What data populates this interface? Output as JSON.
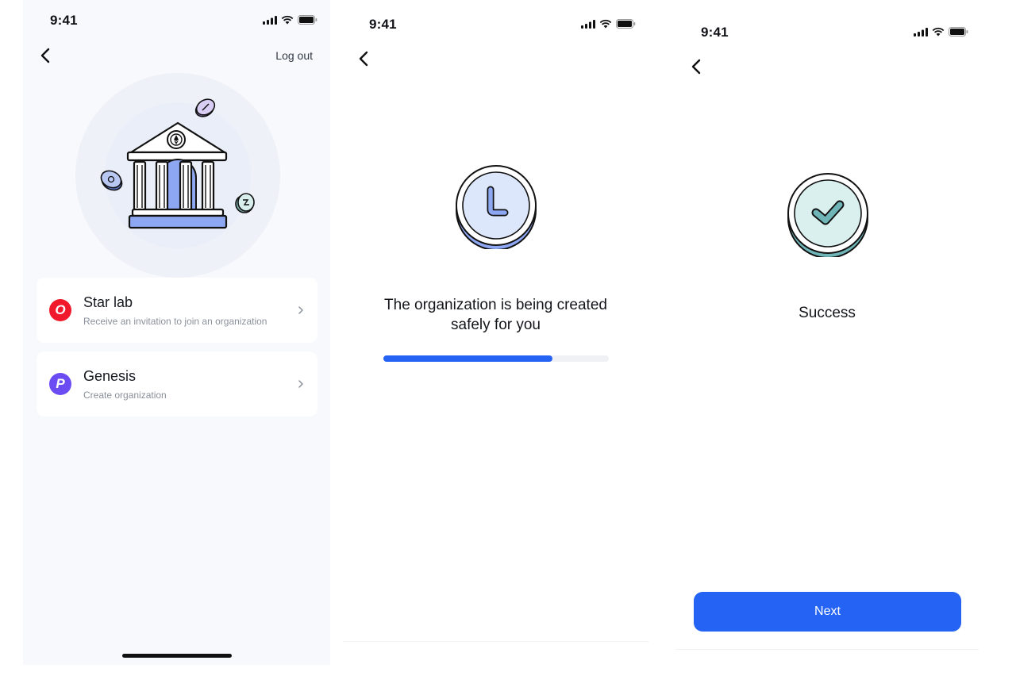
{
  "status_bar": {
    "time": "9:41"
  },
  "screen1": {
    "logout_label": "Log out",
    "cards": [
      {
        "badge_letter": "O",
        "badge_color": "#f0192b",
        "title": "Star lab",
        "subtitle": "Receive an invitation to join an organization"
      },
      {
        "badge_letter": "P",
        "badge_color": "#6a4cf2",
        "title": "Genesis",
        "subtitle": "Create organization"
      }
    ]
  },
  "screen2": {
    "message_line1": "The organization is being created",
    "message_line2": "safely for you",
    "progress_fraction": 0.75
  },
  "screen3": {
    "message": "Success",
    "next_label": "Next"
  },
  "colors": {
    "accent": "#2563f5",
    "illustration_blue": "#8ea7f3",
    "success_teal": "#6fb4b6"
  }
}
